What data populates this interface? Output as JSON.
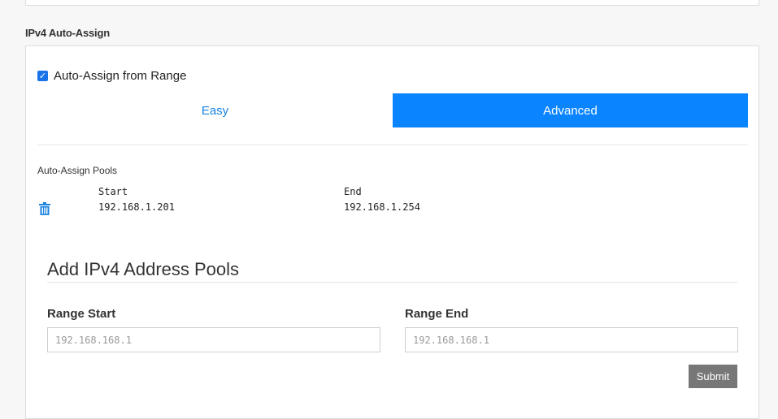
{
  "section": {
    "title": "IPv4 Auto-Assign"
  },
  "auto_assign": {
    "checkbox_label": "Auto-Assign from Range",
    "checked": true
  },
  "mode_tabs": {
    "easy": "Easy",
    "advanced": "Advanced",
    "selected": "Advanced"
  },
  "pools": {
    "heading": "Auto-Assign Pools",
    "columns": {
      "start": "Start",
      "end": "End"
    },
    "rows": [
      {
        "start": "192.168.1.201",
        "end": "192.168.1.254"
      }
    ]
  },
  "add_pool": {
    "title": "Add IPv4 Address Pools",
    "range_start_label": "Range Start",
    "range_start_placeholder": "192.168.168.1",
    "range_end_label": "Range End",
    "range_end_placeholder": "192.168.168.1",
    "submit_label": "Submit"
  },
  "colors": {
    "accent": "#0a84ff",
    "link": "#1a82e0",
    "submit_bg": "#777777"
  },
  "icons": {
    "checkbox": "check-icon",
    "delete": "trash-icon"
  }
}
